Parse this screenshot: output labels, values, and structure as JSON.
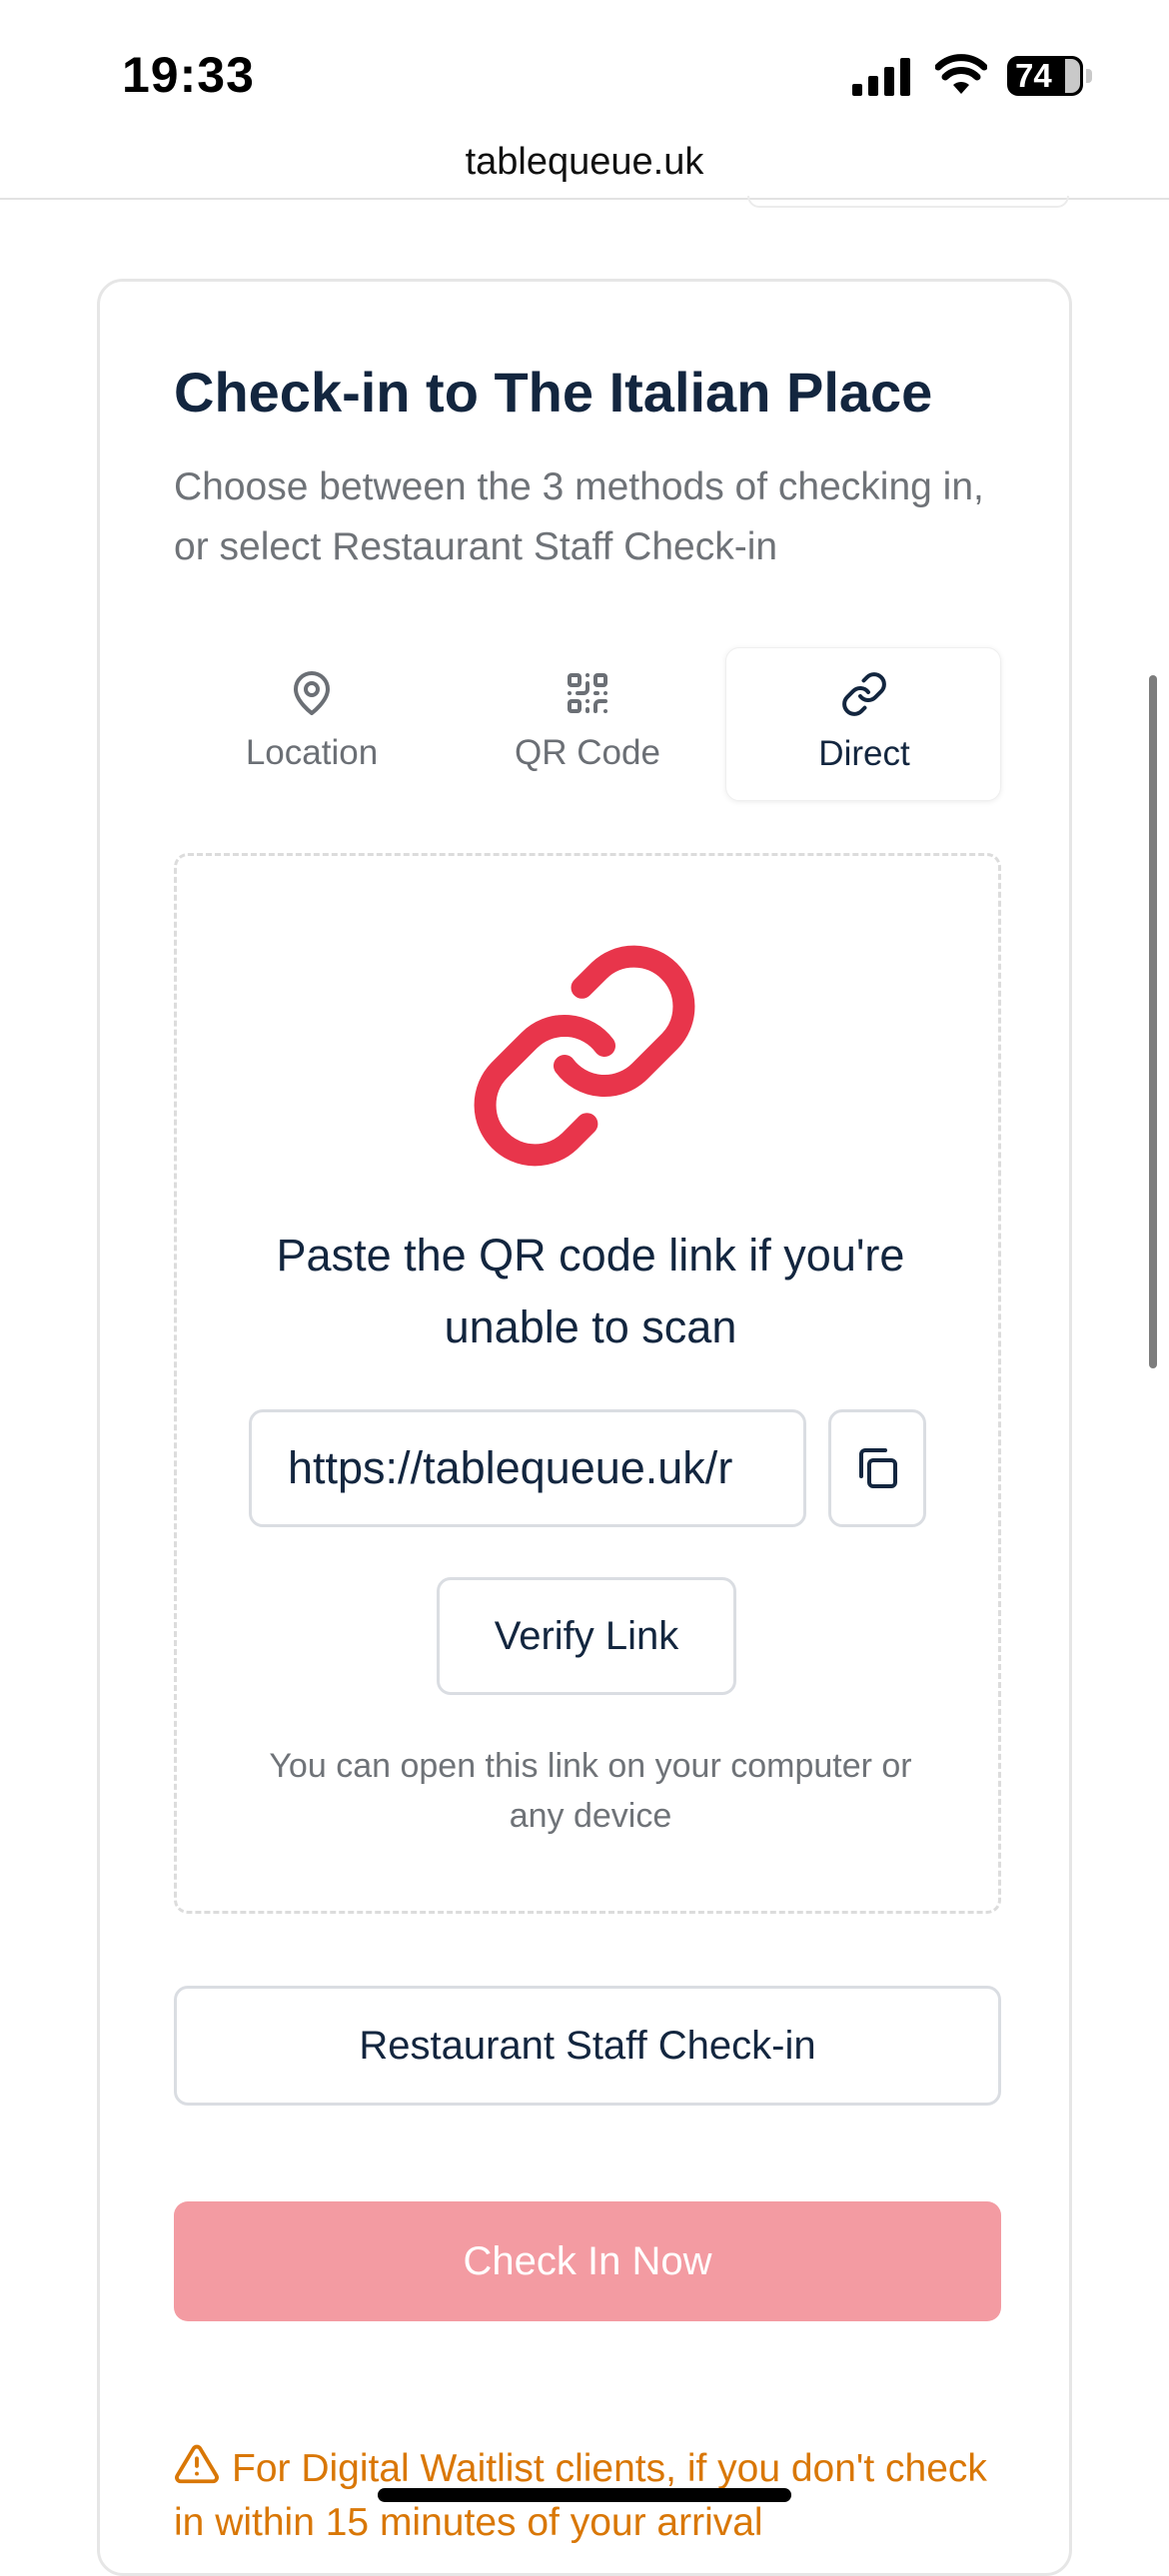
{
  "status_bar": {
    "time": "19:33",
    "battery": "74",
    "icons": [
      "signal-icon",
      "wifi-icon",
      "battery-icon"
    ]
  },
  "browser": {
    "url": "tablequeue.uk"
  },
  "card": {
    "title": "Check-in to The Italian Place",
    "subtitle": "Choose between the 3 methods of checking in, or select Restaurant Staff Check-in",
    "tabs": [
      {
        "label": "Location",
        "icon": "map-pin-icon",
        "active": false
      },
      {
        "label": "QR Code",
        "icon": "qr-code-icon",
        "active": false
      },
      {
        "label": "Direct",
        "icon": "link-icon",
        "active": true
      }
    ],
    "direct_panel": {
      "icon": "link-icon",
      "heading": "Paste the QR code link if you're unable to scan",
      "link_value": "https://tablequeue.uk/r",
      "copy_icon": "copy-icon",
      "verify_label": "Verify Link",
      "note": "You can open this link on your computer or any device"
    },
    "staff_label": "Restaurant Staff Check-in",
    "checkin_label": "Check In Now",
    "warning": "For Digital Waitlist clients, if you don't check in within 15 minutes of your arrival"
  },
  "colors": {
    "accent": "#e8354b",
    "checkin_disabled": "#f39ba2",
    "warning": "#d97706",
    "text_dark": "#13263f",
    "text_muted": "#6f7378"
  }
}
